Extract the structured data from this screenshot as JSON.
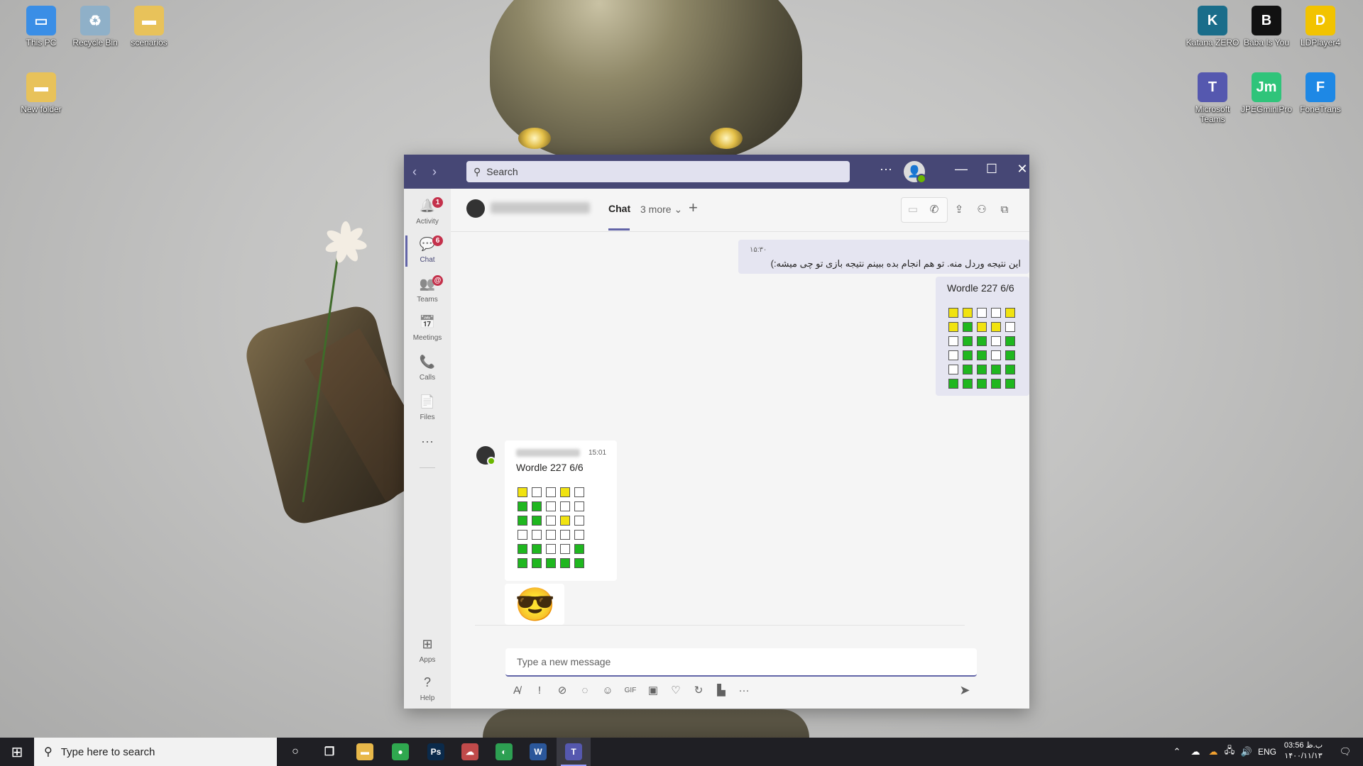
{
  "desktop": {
    "icons_left": [
      {
        "label": "This PC",
        "color": "#3a8ee6",
        "glyph": "▭"
      },
      {
        "label": "Recycle Bin",
        "color": "#8fb0c8",
        "glyph": "♻"
      },
      {
        "label": "scenarios",
        "color": "#e8c25a",
        "glyph": "▬"
      },
      {
        "label": "New folder",
        "color": "#e8c25a",
        "glyph": "▬"
      }
    ],
    "icons_right": [
      {
        "label": "Katana ZERO",
        "color": "#1a6d8a",
        "glyph": "K"
      },
      {
        "label": "Baba Is You",
        "color": "#111111",
        "glyph": "B"
      },
      {
        "label": "LDPlayer4",
        "color": "#f2c300",
        "glyph": "D"
      },
      {
        "label": "Microsoft Teams",
        "color": "#5558af",
        "glyph": "T"
      },
      {
        "label": "JPEGminiPro",
        "color": "#2fc47a",
        "glyph": "Jm"
      },
      {
        "label": "FoneTrans",
        "color": "#1e88e5",
        "glyph": "F"
      }
    ]
  },
  "teams": {
    "search_placeholder": "Search",
    "titlebar": {
      "more": "···",
      "minimize": "—",
      "maximize": "☐",
      "close": "✕"
    },
    "rail": [
      {
        "label": "Activity",
        "icon": "bell-icon",
        "glyph": "🔔",
        "badge": "1"
      },
      {
        "label": "Chat",
        "icon": "chat-icon",
        "glyph": "💬",
        "badge": "6",
        "active": true
      },
      {
        "label": "Teams",
        "icon": "teams-icon",
        "glyph": "👥",
        "badge": "@"
      },
      {
        "label": "Meetings",
        "icon": "calendar-icon",
        "glyph": "📅"
      },
      {
        "label": "Calls",
        "icon": "phone-icon",
        "glyph": "📞"
      },
      {
        "label": "Files",
        "icon": "file-icon",
        "glyph": "📄"
      }
    ],
    "rail_more": "···",
    "rail_bottom": [
      {
        "label": "Apps",
        "icon": "apps-icon",
        "glyph": "⊞"
      },
      {
        "label": "Help",
        "icon": "help-icon",
        "glyph": "?"
      }
    ],
    "header": {
      "tab_chat": "Chat",
      "tab_more": "3 more ⌄",
      "add": "+"
    },
    "messages": {
      "me_time": "۱۵:۳۰",
      "me_text": "این نتیجه وردل منه. تو هم انجام بده ببینم نتیجه بازی تو چی میشه:)",
      "me_wordle_title": "Wordle 227 6/6",
      "me_grid": [
        [
          "y",
          "y",
          "w",
          "w",
          "y"
        ],
        [
          "y",
          "g",
          "y",
          "y",
          "w"
        ],
        [
          "w",
          "g",
          "g",
          "w",
          "g"
        ],
        [
          "w",
          "g",
          "g",
          "w",
          "g"
        ],
        [
          "w",
          "g",
          "g",
          "g",
          "g"
        ],
        [
          "g",
          "g",
          "g",
          "g",
          "g"
        ]
      ],
      "them_time": "15:01",
      "them_wordle_title": "Wordle 227 6/6",
      "them_grid": [
        [
          "y",
          "w",
          "w",
          "y",
          "w"
        ],
        [
          "g",
          "g",
          "w",
          "w",
          "w"
        ],
        [
          "g",
          "g",
          "w",
          "y",
          "w"
        ],
        [
          "w",
          "w",
          "w",
          "w",
          "w"
        ],
        [
          "g",
          "g",
          "w",
          "w",
          "g"
        ],
        [
          "g",
          "g",
          "g",
          "g",
          "g"
        ]
      ],
      "them_emoji": "😎"
    },
    "compose_placeholder": "Type a new message"
  },
  "taskbar": {
    "search_placeholder": "Type here to search",
    "apps": [
      {
        "name": "cortana",
        "glyph": "○",
        "color": "transparent"
      },
      {
        "name": "task-view",
        "glyph": "❐",
        "color": "transparent"
      },
      {
        "name": "file-explorer",
        "glyph": "▬",
        "color": "#e8b84a"
      },
      {
        "name": "chrome",
        "glyph": "●",
        "color": "#2fa84f"
      },
      {
        "name": "photoshop",
        "glyph": "Ps",
        "color": "#0b2a4a"
      },
      {
        "name": "app-cloud",
        "glyph": "☁",
        "color": "#c04a4a"
      },
      {
        "name": "app-globe",
        "glyph": "◐",
        "color": "#2d9f52"
      },
      {
        "name": "word",
        "glyph": "W",
        "color": "#2b579a"
      },
      {
        "name": "teams",
        "glyph": "T",
        "color": "#5558af"
      }
    ],
    "tray": {
      "lang": "ENG",
      "time": "03:56 ب.ظ",
      "date": "۱۴۰۰/۱۱/۱۳"
    }
  }
}
